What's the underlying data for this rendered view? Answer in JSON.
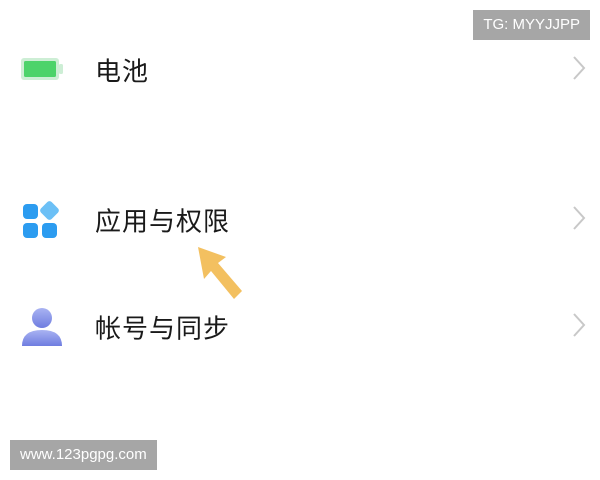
{
  "settings": {
    "items": [
      {
        "label": "电池",
        "icon": "battery-icon"
      },
      {
        "label": "应用与权限",
        "icon": "apps-icon"
      },
      {
        "label": "帐号与同步",
        "icon": "account-icon"
      }
    ]
  },
  "watermarks": {
    "top": "TG: MYYJJPP",
    "bottom": "www.123pgpg.com"
  },
  "colors": {
    "battery": "#4cd36a",
    "apps": "#2c9cf0",
    "account": "#7f8ce8",
    "arrow": "#f3c060",
    "chevron": "#c8c8c8"
  }
}
